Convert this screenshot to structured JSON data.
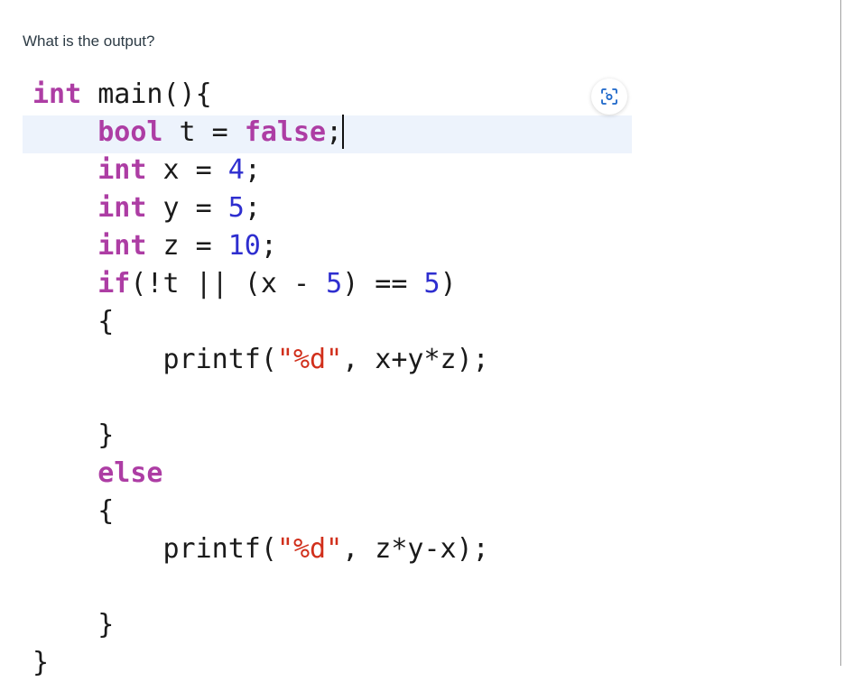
{
  "question": {
    "text": "What is the output?"
  },
  "code": {
    "cursor_line_index": 1,
    "lines": [
      {
        "indent": "",
        "tokens": [
          {
            "t": "int",
            "c": "kw"
          },
          {
            "t": " main(){",
            "c": "plain"
          }
        ]
      },
      {
        "indent": "    ",
        "tokens": [
          {
            "t": "bool",
            "c": "kw"
          },
          {
            "t": " t = ",
            "c": "plain"
          },
          {
            "t": "false",
            "c": "kw"
          },
          {
            "t": ";",
            "c": "plain"
          }
        ]
      },
      {
        "indent": "    ",
        "tokens": [
          {
            "t": "int",
            "c": "kw"
          },
          {
            "t": " x = ",
            "c": "plain"
          },
          {
            "t": "4",
            "c": "num"
          },
          {
            "t": ";",
            "c": "plain"
          }
        ]
      },
      {
        "indent": "    ",
        "tokens": [
          {
            "t": "int",
            "c": "kw"
          },
          {
            "t": " y = ",
            "c": "plain"
          },
          {
            "t": "5",
            "c": "num"
          },
          {
            "t": ";",
            "c": "plain"
          }
        ]
      },
      {
        "indent": "    ",
        "tokens": [
          {
            "t": "int",
            "c": "kw"
          },
          {
            "t": " z = ",
            "c": "plain"
          },
          {
            "t": "10",
            "c": "num"
          },
          {
            "t": ";",
            "c": "plain"
          }
        ]
      },
      {
        "indent": "    ",
        "tokens": [
          {
            "t": "if",
            "c": "kw"
          },
          {
            "t": "(!t || (x - ",
            "c": "plain"
          },
          {
            "t": "5",
            "c": "num"
          },
          {
            "t": ") == ",
            "c": "plain"
          },
          {
            "t": "5",
            "c": "num"
          },
          {
            "t": ")",
            "c": "plain"
          }
        ]
      },
      {
        "indent": "    ",
        "tokens": [
          {
            "t": "{",
            "c": "plain"
          }
        ]
      },
      {
        "indent": "        ",
        "tokens": [
          {
            "t": "printf(",
            "c": "plain"
          },
          {
            "t": "\"%d\"",
            "c": "str"
          },
          {
            "t": ", x+y*z);",
            "c": "plain"
          }
        ]
      },
      {
        "indent": "",
        "tokens": []
      },
      {
        "indent": "    ",
        "tokens": [
          {
            "t": "}",
            "c": "plain"
          }
        ]
      },
      {
        "indent": "    ",
        "tokens": [
          {
            "t": "else",
            "c": "kw"
          }
        ]
      },
      {
        "indent": "    ",
        "tokens": [
          {
            "t": "{",
            "c": "plain"
          }
        ]
      },
      {
        "indent": "        ",
        "tokens": [
          {
            "t": "printf(",
            "c": "plain"
          },
          {
            "t": "\"%d\"",
            "c": "str"
          },
          {
            "t": ", z*y-x);",
            "c": "plain"
          }
        ]
      },
      {
        "indent": "",
        "tokens": []
      },
      {
        "indent": "    ",
        "tokens": [
          {
            "t": "}",
            "c": "plain"
          }
        ]
      },
      {
        "indent": "",
        "tokens": [
          {
            "t": "}",
            "c": "plain"
          }
        ]
      }
    ]
  },
  "colors": {
    "keyword": "#ad3da4",
    "number": "#2e2ecf",
    "string": "#d12f1b",
    "text": "#1a1a1a",
    "line_highlight": "#edf3fc",
    "icon_accent": "#1b66c9"
  },
  "icons": {
    "ocr_button": "scan-text-icon"
  }
}
